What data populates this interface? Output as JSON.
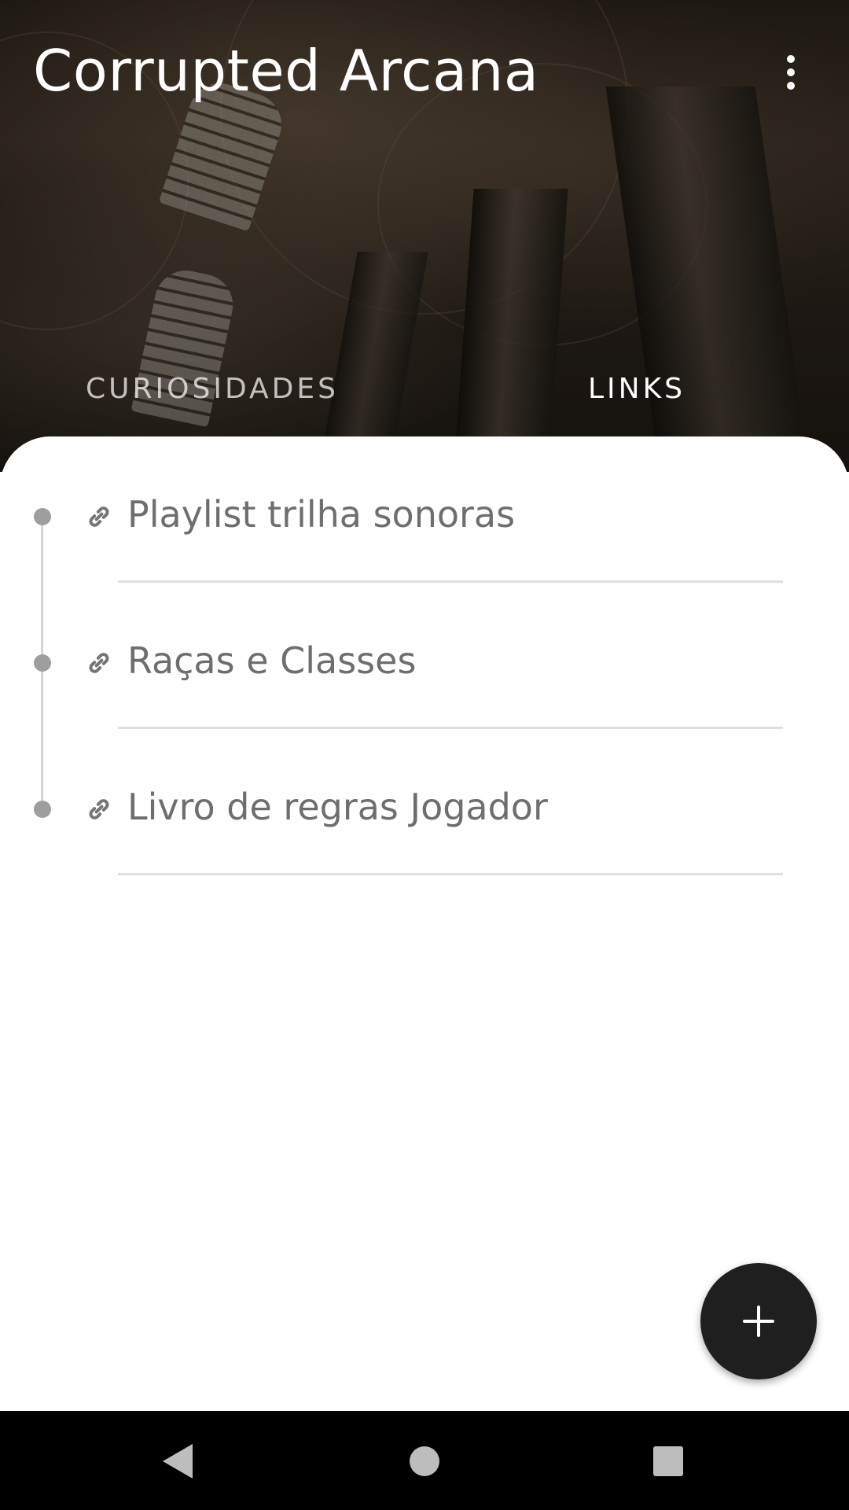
{
  "app": {
    "title": "Corrupted Arcana"
  },
  "tabs": [
    {
      "label": "CURIOSIDADES",
      "active": false
    },
    {
      "label": "LINKS",
      "active": true
    }
  ],
  "links": [
    {
      "label": "Playlist trilha sonoras",
      "icon": "link-icon"
    },
    {
      "label": "Raças e Classes",
      "icon": "link-icon"
    },
    {
      "label": "Livro de regras Jogador",
      "icon": "link-icon"
    }
  ],
  "fab": {
    "icon": "plus-icon"
  },
  "navbar": {
    "back": "back-icon",
    "home": "home-icon",
    "recents": "recents-icon"
  },
  "colors": {
    "fab": "#1f1f1f",
    "text_muted": "#6e6e6e",
    "timeline": "#9e9e9e",
    "divider": "#e0e0e0"
  }
}
